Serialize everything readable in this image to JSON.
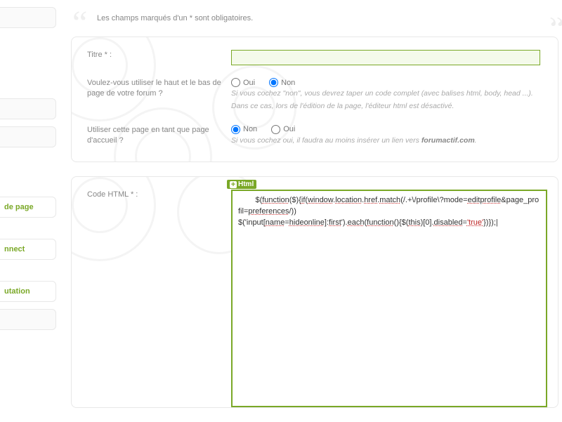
{
  "sidebar": {
    "items": [
      {
        "label": ""
      },
      {
        "label": ""
      },
      {
        "label": ""
      },
      {
        "label": "de page"
      },
      {
        "label": "nnect"
      },
      {
        "label": "utation"
      },
      {
        "label": ""
      }
    ]
  },
  "intro": {
    "text": "Les champs marqués d'un * sont obligatoires."
  },
  "form": {
    "title_label": "Titre * :",
    "title_value": "",
    "use_header_label": "Voulez-vous utiliser le haut et le bas de page de votre forum ?",
    "use_header_opts": {
      "yes": "Oui",
      "no": "Non",
      "selected": "no"
    },
    "use_header_hint1": "Si vous cochez \"non\", vous devrez taper un code complet (avec balises html, body, head ...).",
    "use_header_hint2": "Dans ce cas, lors de l'édition de la page, l'éditeur html est désactivé.",
    "homepage_label": "Utiliser cette page en tant que page d'accueil ?",
    "homepage_opts": {
      "yes": "Oui",
      "no": "Non",
      "selected": "no"
    },
    "homepage_hint": "Si vous cochez oui, il faudra au moins insérer un lien vers ",
    "homepage_hint_bold": "forumactif.com",
    "code_label": "Code HTML * :",
    "editor_tab": "Html",
    "code_value": "        $(function($){if(window.location.href.match(/.+\\/profile\\?mode=editprofile&page_profil=preferences/))\n$('input[name=hideonline]:first').each(function(){$(this)[0].disabled='true'})});|"
  }
}
